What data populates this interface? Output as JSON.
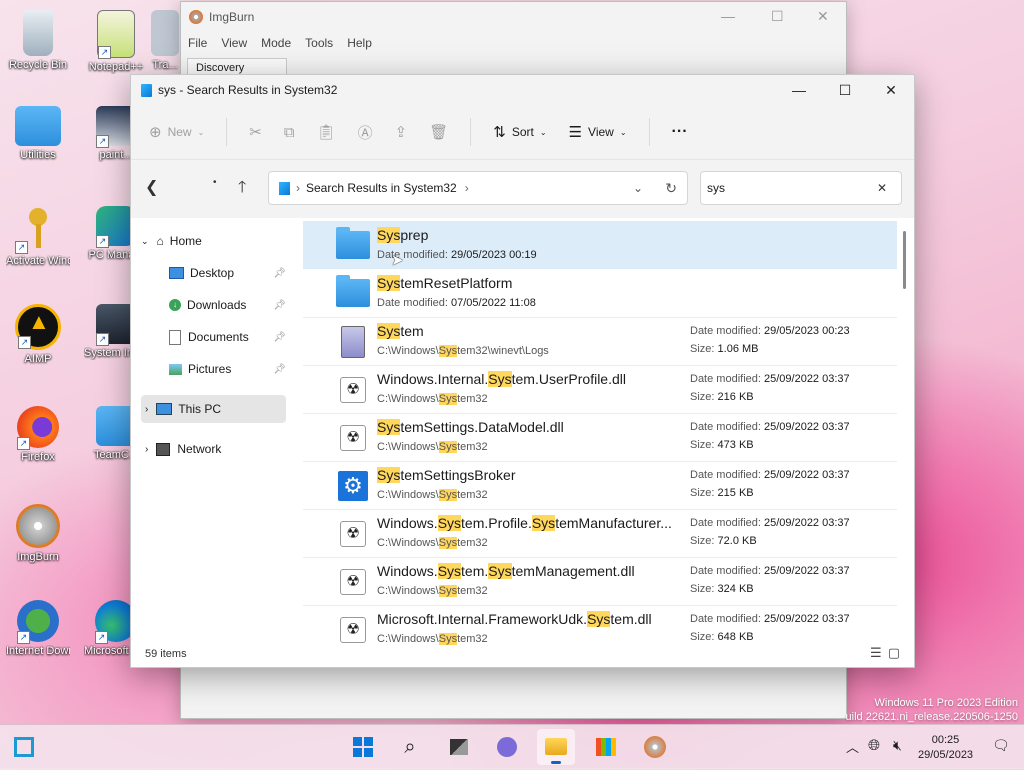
{
  "desktop": {
    "icons": [
      {
        "label": "Recycle Bin"
      },
      {
        "label": "Utilities"
      },
      {
        "label": "Activate Windows"
      },
      {
        "label": "AIMP"
      },
      {
        "label": "Firefox"
      },
      {
        "label": "ImgBurn"
      },
      {
        "label": "Internet Downlo..."
      },
      {
        "label": "Notepad++"
      },
      {
        "label": "paint..."
      },
      {
        "label": "PC Mana..."
      },
      {
        "label": "System Inform..."
      },
      {
        "label": "TeamC..."
      },
      {
        "label": "Microsoft Edge"
      },
      {
        "label": "Tra..."
      }
    ]
  },
  "imgburn": {
    "title": "ImgBurn",
    "menu": [
      "File",
      "View",
      "Mode",
      "Tools",
      "Help"
    ],
    "tab": "Discovery"
  },
  "explorer": {
    "title": "sys - Search Results in System32",
    "commands": {
      "new": "New",
      "sort": "Sort",
      "view": "View",
      "more": "···"
    },
    "address": {
      "path": "Search Results in System32"
    },
    "search": {
      "value": "sys"
    },
    "sidebar": {
      "home": "Home",
      "desktop": "Desktop",
      "downloads": "Downloads",
      "documents": "Documents",
      "pictures": "Pictures",
      "this_pc": "This PC",
      "network": "Network"
    },
    "files": [
      {
        "hl": "Sys",
        "rest": "prep",
        "sub_label": "Date modified:",
        "sub_value": "29/05/2023 00:19"
      },
      {
        "hl": "Sys",
        "rest": "temResetPlatform",
        "sub_label": "Date modified:",
        "sub_value": "07/05/2022 11:08"
      },
      {
        "hl": "Sys",
        "rest": "tem",
        "path_pre": "C:\\Windows\\",
        "path_hl": "Sys",
        "path_post": "tem32\\winevt\\Logs",
        "date": "29/05/2023 00:23",
        "size": "1.06 MB"
      },
      {
        "pre": "Windows.Internal.",
        "hl": "Sys",
        "rest": "tem.UserProfile.dll",
        "path_pre": "C:\\Windows\\",
        "path_hl": "Sys",
        "path_post": "tem32",
        "date": "25/09/2022 03:37",
        "size": "216 KB"
      },
      {
        "hl": "Sys",
        "rest": "temSettings.DataModel.dll",
        "path_pre": "C:\\Windows\\",
        "path_hl": "Sys",
        "path_post": "tem32",
        "date": "25/09/2022 03:37",
        "size": "473 KB"
      },
      {
        "hl": "Sys",
        "rest": "temSettingsBroker",
        "path_pre": "C:\\Windows\\",
        "path_hl": "Sys",
        "path_post": "tem32",
        "date": "25/09/2022 03:37",
        "size": "215 KB"
      },
      {
        "pre": "Windows.",
        "hl": "Sys",
        "rest": "tem.Profile.",
        "hl2": "Sys",
        "rest2": "temManufacturer...",
        "path_pre": "C:\\Windows\\",
        "path_hl": "Sys",
        "path_post": "tem32",
        "date": "25/09/2022 03:37",
        "size": "72.0 KB"
      },
      {
        "pre": "Windows.",
        "hl": "Sys",
        "rest": "tem.",
        "hl2": "Sys",
        "rest2": "temManagement.dll",
        "path_pre": "C:\\Windows\\",
        "path_hl": "Sys",
        "path_post": "tem32",
        "date": "25/09/2022 03:37",
        "size": "324 KB"
      },
      {
        "pre": "Microsoft.Internal.FrameworkUdk.",
        "hl": "Sys",
        "rest": "tem.dll",
        "path_pre": "C:\\Windows\\",
        "path_hl": "Sys",
        "path_post": "tem32",
        "date": "25/09/2022 03:37",
        "size": "648 KB"
      }
    ],
    "labels": {
      "date_modified": "Date modified:",
      "size": "Size:"
    },
    "status": "59 items"
  },
  "watermark": {
    "line1": "Windows 11 Pro 2023 Edition",
    "line2": "uild 22621.ni_release.220506-1250"
  },
  "taskbar": {
    "time": "00:25",
    "date": "29/05/2023"
  },
  "colors": {
    "accent": "#0a66c2",
    "highlight": "#ffd75c",
    "selection": "#dcecf9"
  }
}
